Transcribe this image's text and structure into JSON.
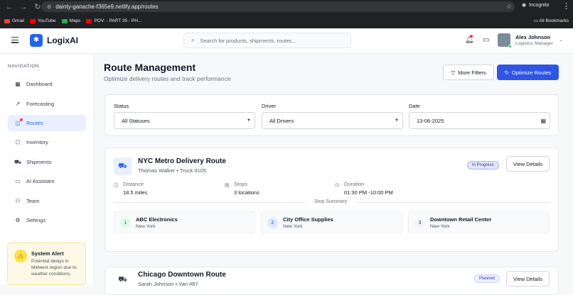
{
  "browser": {
    "url": "dainty-ganache-f365e9.netlify.app/routes",
    "incognito_label": "Incognito",
    "bookmarks": [
      {
        "label": "Gmail",
        "color": "#ea4335"
      },
      {
        "label": "YouTube",
        "color": "#ff0000"
      },
      {
        "label": "Maps",
        "color": "#34a853"
      },
      {
        "label": "POV: - PART 35 - PH...",
        "color": "#ff0000"
      }
    ],
    "all_bookmarks": "All Bookmarks"
  },
  "header": {
    "brand": "LogixAI",
    "search_placeholder": "Search for products, shipments, routes...",
    "user_name": "Alex Johnson",
    "user_role": "Logistics Manager"
  },
  "sidebar": {
    "section_label": "NAVIGATION",
    "items": [
      {
        "label": "Dashboard",
        "icon": "grid-icon",
        "glyph": "▦"
      },
      {
        "label": "Forecasting",
        "icon": "trend-icon",
        "glyph": "↗"
      },
      {
        "label": "Routes",
        "icon": "map-icon",
        "glyph": "◫",
        "active": true
      },
      {
        "label": "Inventory",
        "icon": "box-icon",
        "glyph": "⬡"
      },
      {
        "label": "Shipments",
        "icon": "truck-icon",
        "glyph": "⛟"
      },
      {
        "label": "AI Assistant",
        "icon": "chat-icon",
        "glyph": "▭"
      },
      {
        "label": "Team",
        "icon": "users-icon",
        "glyph": "⚇"
      },
      {
        "label": "Settings",
        "icon": "gear-icon",
        "glyph": "⚙"
      }
    ],
    "alert": {
      "title": "System Alert",
      "body": "Potential delays in Midwest region due to weather conditions."
    }
  },
  "page": {
    "title": "Route Management",
    "subtitle": "Optimize delivery routes and track performance",
    "more_filters": "More Filters",
    "optimize": "Optimize Routes"
  },
  "filters": {
    "status_label": "Status",
    "status_value": "All Statuses",
    "driver_label": "Driver",
    "driver_value": "All Drivers",
    "date_label": "Date",
    "date_value": "13-06-2025"
  },
  "routes": [
    {
      "name": "NYC Metro Delivery Route",
      "meta": "Thomas Walker • Truck #105",
      "status": "In Progress",
      "view": "View Details",
      "distance_label": "Distance",
      "distance": "18.5 miles",
      "stops_label": "Stops",
      "stops": "3 locations",
      "duration_label": "Duration",
      "duration": "01:30 PM -10:00 PM",
      "summary_label": "Stop Summary",
      "stop_list": [
        {
          "num": "1",
          "name": "ABC Electronics",
          "city": "New York"
        },
        {
          "num": "2",
          "name": "City Office Supplies",
          "city": "New York"
        },
        {
          "num": "3",
          "name": "Downtown Retail Center",
          "city": "New York"
        }
      ]
    },
    {
      "name": "Chicago Downtown Route",
      "meta": "Sarah Johnson • Van #87",
      "status": "Planned",
      "view": "View Details"
    }
  ]
}
